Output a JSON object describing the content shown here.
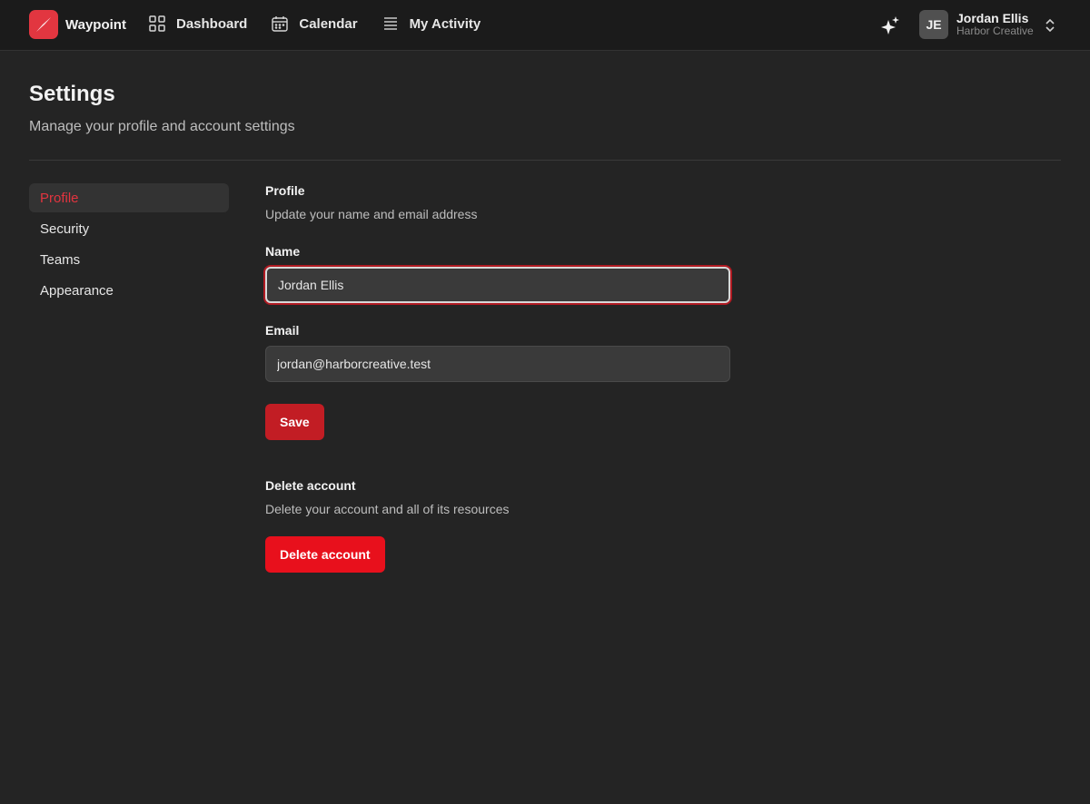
{
  "app": {
    "name": "Waypoint",
    "logo_color": "#e23640"
  },
  "nav": [
    {
      "label": "Dashboard",
      "icon": "grid-icon"
    },
    {
      "label": "Calendar",
      "icon": "calendar-icon"
    },
    {
      "label": "My Activity",
      "icon": "list-icon"
    }
  ],
  "user": {
    "initials": "JE",
    "name": "Jordan Ellis",
    "org": "Harbor Creative"
  },
  "header": {
    "title": "Settings",
    "subtitle": "Manage your profile and account settings"
  },
  "sidebar": {
    "items": [
      "Profile",
      "Security",
      "Teams",
      "Appearance"
    ],
    "active": "Profile"
  },
  "profile": {
    "title": "Profile",
    "description": "Update your name and email address",
    "name_label": "Name",
    "name_value": "Jordan Ellis",
    "email_label": "Email",
    "email_value": "jordan@harborcreative.test",
    "save_label": "Save"
  },
  "delete": {
    "title": "Delete account",
    "description": "Delete your account and all of its resources",
    "button_label": "Delete account"
  },
  "colors": {
    "accent": "#e3343f",
    "save": "#c21d24",
    "danger": "#e8101c"
  }
}
